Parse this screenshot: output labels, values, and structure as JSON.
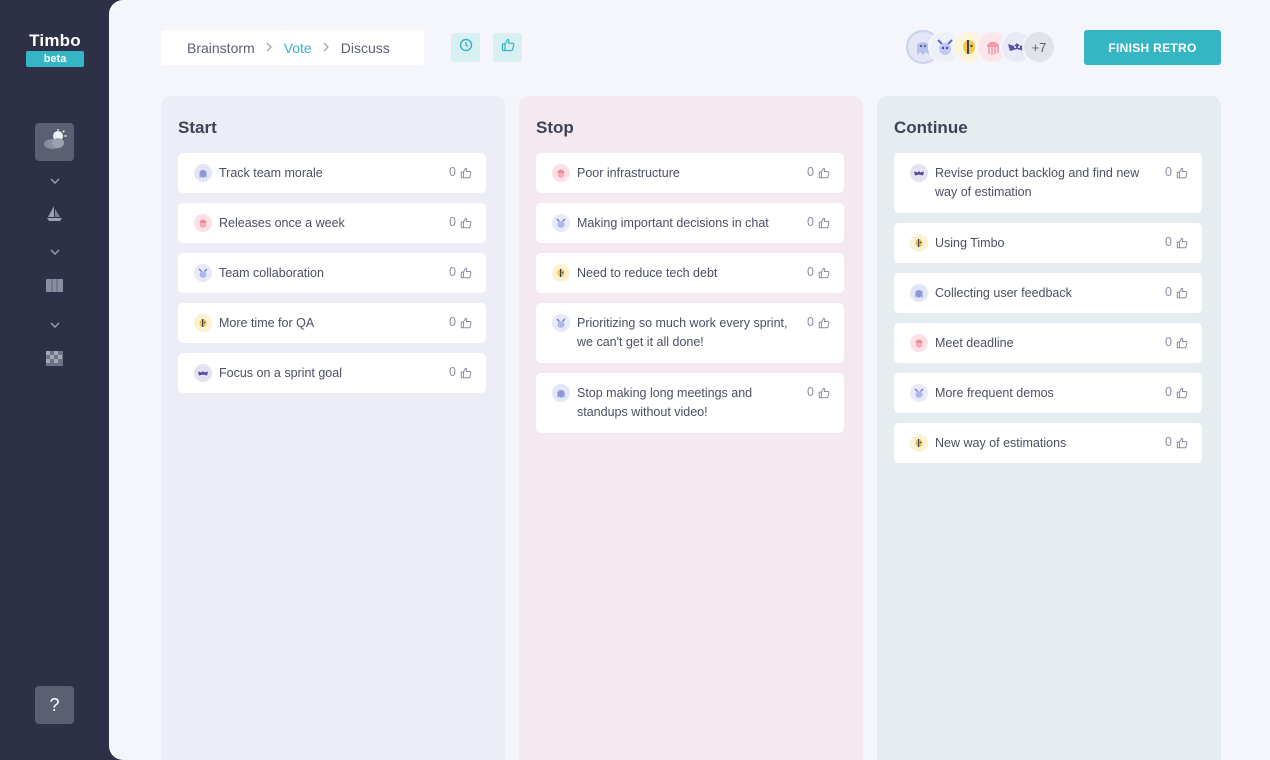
{
  "app": {
    "logo_name": "Timbo",
    "logo_badge": "beta"
  },
  "sidebar": {
    "help_label": "?",
    "icons": [
      "weather-icon",
      "sailboat-icon",
      "board-icon",
      "checkered-flag-icon"
    ]
  },
  "breadcrumb": {
    "steps": [
      "Brainstorm",
      "Vote",
      "Discuss"
    ],
    "active": "Vote",
    "separator": ">"
  },
  "toolbar": {
    "timer_icon": "clock-icon",
    "vote_icon": "thumbs-up-icon"
  },
  "participants": {
    "extra_count": "+7"
  },
  "finish_button": "FINISH RETRO",
  "colors": {
    "accent": "#36b5c4",
    "sidebar": "#2d3147",
    "start_bg": "#ededf8",
    "stop_bg": "#f4e9f0",
    "continue_bg": "#e6edf1"
  },
  "columns": [
    {
      "title": "Start",
      "cards": [
        {
          "text": "Track team morale",
          "votes": "0",
          "avatar": "purple-blob"
        },
        {
          "text": "Releases once a week",
          "votes": "0",
          "avatar": "pink-jellyfish"
        },
        {
          "text": "Team collaboration",
          "votes": "0",
          "avatar": "blue-creature"
        },
        {
          "text": "More time for QA",
          "votes": "0",
          "avatar": "yellow-fish"
        },
        {
          "text": "Focus on a sprint goal",
          "votes": "0",
          "avatar": "violet-bat"
        }
      ]
    },
    {
      "title": "Stop",
      "cards": [
        {
          "text": "Poor infrastructure",
          "votes": "0",
          "avatar": "pink-jellyfish"
        },
        {
          "text": "Making important decisions in chat",
          "votes": "0",
          "avatar": "blue-creature"
        },
        {
          "text": "Need to reduce tech debt",
          "votes": "0",
          "avatar": "yellow-fish"
        },
        {
          "text": "Prioritizing so much work every sprint, we can't get it all done!",
          "votes": "0",
          "avatar": "blue-creature"
        },
        {
          "text": "Stop making long meetings and standups without video!",
          "votes": "0",
          "avatar": "purple-blob"
        }
      ]
    },
    {
      "title": "Continue",
      "cards": [
        {
          "text": "Revise product backlog and find new way of estimation",
          "votes": "0",
          "avatar": "violet-bat"
        },
        {
          "text": "Using Timbo",
          "votes": "0",
          "avatar": "yellow-fish"
        },
        {
          "text": "Collecting user feedback",
          "votes": "0",
          "avatar": "purple-blob"
        },
        {
          "text": "Meet deadline",
          "votes": "0",
          "avatar": "pink-jellyfish"
        },
        {
          "text": "More frequent demos",
          "votes": "0",
          "avatar": "blue-creature"
        },
        {
          "text": "New way of estimations",
          "votes": "0",
          "avatar": "yellow-fish"
        }
      ]
    }
  ]
}
